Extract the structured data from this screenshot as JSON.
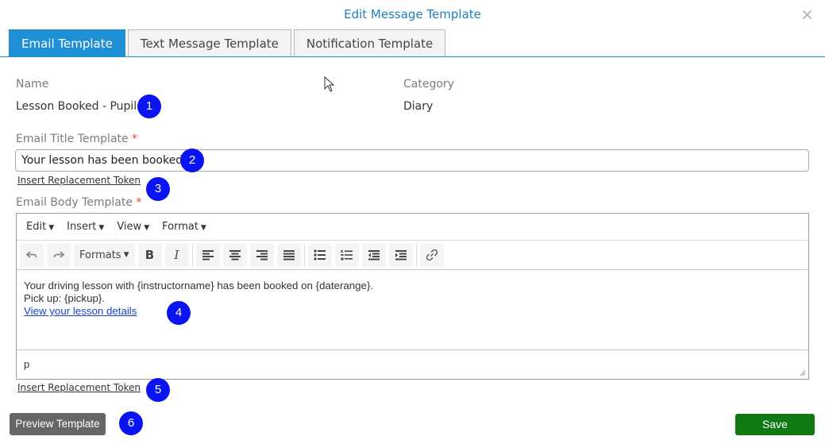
{
  "dialog": {
    "title": "Edit Message Template",
    "close_icon": "×"
  },
  "tabs": [
    {
      "label": "Email Template",
      "active": true
    },
    {
      "label": "Text Message Template",
      "active": false
    },
    {
      "label": "Notification Template",
      "active": false
    }
  ],
  "fields": {
    "name_label": "Name",
    "name_value": "Lesson Booked - Pupil",
    "category_label": "Category",
    "category_value": "Diary",
    "title_label": "Email Title Template",
    "required_mark": "*",
    "title_value": "Your lesson has been booked",
    "body_label": "Email Body Template",
    "insert_token_label": "Insert Replacement Token"
  },
  "editor": {
    "menus": [
      "Edit",
      "Insert",
      "View",
      "Format"
    ],
    "formats_label": "Formats",
    "bold_label": "B",
    "italic_label": "I",
    "content": {
      "line1": "Your driving lesson with {instructorname} has been booked on {daterange}.",
      "line2": "Pick up: {pickup}.",
      "link": "View your lesson details"
    },
    "status_path": "p"
  },
  "badges": [
    "1",
    "2",
    "3",
    "4",
    "5",
    "6"
  ],
  "buttons": {
    "preview": "Preview Template",
    "save": "Save"
  },
  "colors": {
    "accent": "#1f8fd6",
    "title": "#1f7fc4",
    "badge": "#0a14f0",
    "save": "#0f7a14",
    "preview": "#666666",
    "required": "#e0443a"
  }
}
